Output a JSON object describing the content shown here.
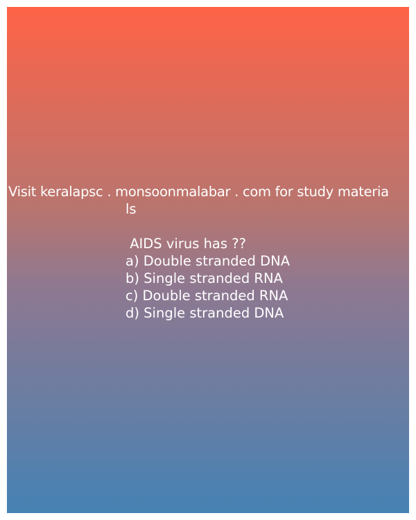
{
  "promo": {
    "line1": "Visit keralapsc . monsoonmalabar . com for study materia",
    "line2": "ls"
  },
  "question": {
    "text": " AIDS virus has ??",
    "options": [
      "a) Double stranded DNA",
      "b) Single stranded RNA",
      "c) Double stranded RNA",
      "d) Single stranded DNA"
    ]
  },
  "colors": {
    "gradient_top": "#ff6347",
    "gradient_bottom": "#4682b4",
    "text": "#ffffff"
  }
}
